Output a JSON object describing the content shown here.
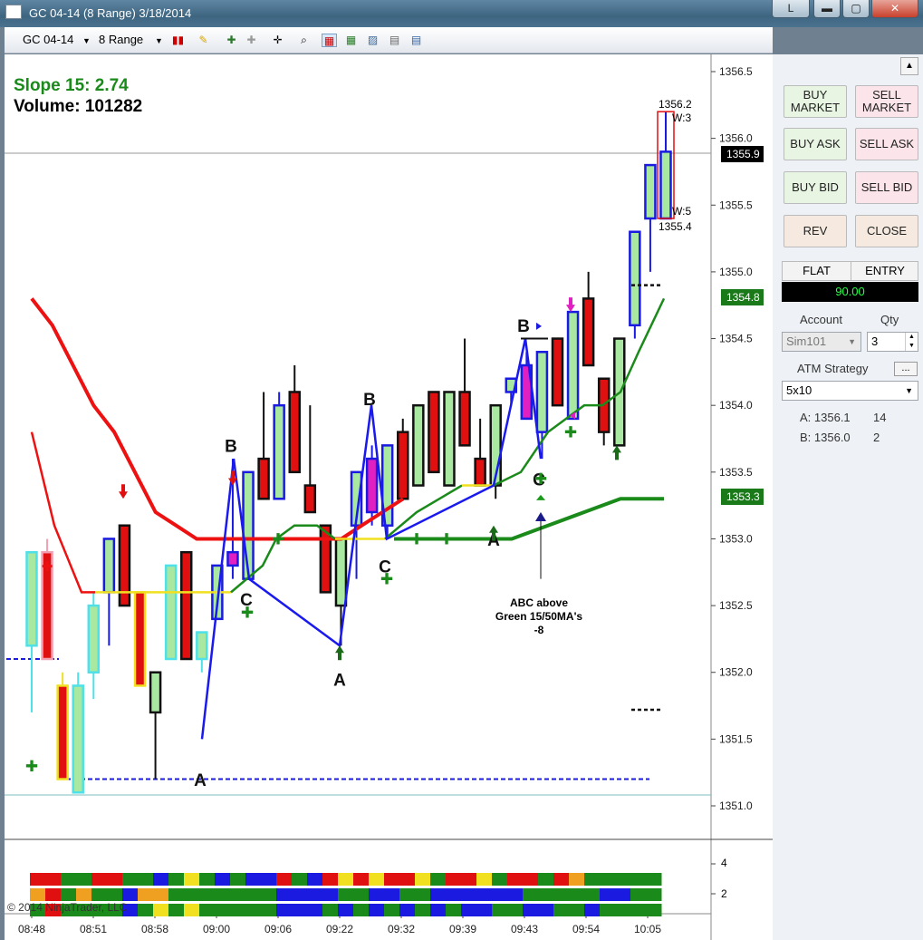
{
  "window": {
    "title": "GC 04-14 (8 Range)  3/18/2014",
    "btn_l": "L",
    "btn_min": "▬",
    "btn_max": "▢",
    "btn_close": "✕"
  },
  "toolbar": {
    "instrument": "GC 04-14",
    "period": "8 Range"
  },
  "chart": {
    "slope_label": "Slope 15: 2.74",
    "volume_label": "Volume: 101282",
    "copyright": "© 2014 NinjaTrader, LLC",
    "bar_high_label": "1356.2",
    "bar_w3": "W:3",
    "bar_w5": "W:5",
    "bar_low_label": "1355.4",
    "note_line1": "ABC above",
    "note_line2": "Green 15/50MA's",
    "note_line3": "-8",
    "price_tag_last": "1355.9",
    "price_tag_ma15": "1354.8",
    "price_tag_ma50": "1353.3",
    "lower_ticks": [
      "4",
      "2"
    ]
  },
  "chart_data": {
    "type": "candlestick",
    "y_axis": {
      "min": 1350.7,
      "max": 1356.6,
      "ticks": [
        "1356.5",
        "1356.0",
        "1355.5",
        "1355.0",
        "1354.5",
        "1354.0",
        "1353.5",
        "1353.0",
        "1352.5",
        "1352.0",
        "1351.5",
        "1351.0"
      ]
    },
    "x_ticks": [
      "08:48",
      "08:51",
      "08:58",
      "09:00",
      "09:06",
      "09:22",
      "09:32",
      "09:39",
      "09:43",
      "09:54",
      "10:05"
    ],
    "candles": [
      {
        "o": 1352.2,
        "h": 1352.6,
        "l": 1351.7,
        "c": 1352.9,
        "color": "cyan"
      },
      {
        "o": 1352.9,
        "h": 1353.0,
        "l": 1352.1,
        "c": 1352.1,
        "color": "pink"
      },
      {
        "o": 1351.9,
        "h": 1352.0,
        "l": 1351.2,
        "c": 1351.2,
        "color": "yellow"
      },
      {
        "o": 1351.1,
        "h": 1352.0,
        "l": 1351.1,
        "c": 1351.9,
        "color": "cyan"
      },
      {
        "o": 1352.0,
        "h": 1352.6,
        "l": 1351.8,
        "c": 1352.5,
        "color": "cyan"
      },
      {
        "o": 1352.6,
        "h": 1353.0,
        "l": 1352.2,
        "c": 1353.0,
        "color": "blue"
      },
      {
        "o": 1353.1,
        "h": 1353.1,
        "l": 1352.5,
        "c": 1352.5,
        "color": "red"
      },
      {
        "o": 1352.6,
        "h": 1352.6,
        "l": 1351.9,
        "c": 1351.9,
        "color": "yellow"
      },
      {
        "o": 1351.7,
        "h": 1352.0,
        "l": 1351.2,
        "c": 1352.0,
        "color": "black"
      },
      {
        "o": 1352.1,
        "h": 1352.8,
        "l": 1352.1,
        "c": 1352.8,
        "color": "cyan"
      },
      {
        "o": 1352.9,
        "h": 1352.9,
        "l": 1352.1,
        "c": 1352.1,
        "color": "red"
      },
      {
        "o": 1352.1,
        "h": 1352.3,
        "l": 1352.0,
        "c": 1352.3,
        "color": "cyan"
      },
      {
        "o": 1352.4,
        "h": 1352.8,
        "l": 1352.4,
        "c": 1352.8,
        "color": "blue"
      },
      {
        "o": 1352.9,
        "h": 1353.6,
        "l": 1352.7,
        "c": 1352.8,
        "color": "magenta"
      },
      {
        "o": 1352.7,
        "h": 1353.5,
        "l": 1352.7,
        "c": 1353.5,
        "color": "blue"
      },
      {
        "o": 1353.3,
        "h": 1354.1,
        "l": 1353.3,
        "c": 1353.6,
        "color": "red"
      },
      {
        "o": 1353.3,
        "h": 1354.1,
        "l": 1353.3,
        "c": 1354.0,
        "color": "blue"
      },
      {
        "o": 1354.1,
        "h": 1354.3,
        "l": 1353.5,
        "c": 1353.5,
        "color": "red"
      },
      {
        "o": 1353.4,
        "h": 1354.0,
        "l": 1353.2,
        "c": 1353.2,
        "color": "red"
      },
      {
        "o": 1353.1,
        "h": 1353.1,
        "l": 1352.6,
        "c": 1352.6,
        "color": "red"
      },
      {
        "o": 1352.5,
        "h": 1353.0,
        "l": 1352.2,
        "c": 1353.0,
        "color": "black"
      },
      {
        "o": 1353.1,
        "h": 1353.5,
        "l": 1352.7,
        "c": 1353.5,
        "color": "blue"
      },
      {
        "o": 1353.6,
        "h": 1353.7,
        "l": 1353.1,
        "c": 1353.2,
        "color": "magenta"
      },
      {
        "o": 1353.1,
        "h": 1353.7,
        "l": 1353.0,
        "c": 1353.7,
        "color": "blue"
      },
      {
        "o": 1353.8,
        "h": 1353.9,
        "l": 1353.3,
        "c": 1353.3,
        "color": "red"
      },
      {
        "o": 1353.4,
        "h": 1354.0,
        "l": 1353.4,
        "c": 1354.0,
        "color": "black"
      },
      {
        "o": 1354.1,
        "h": 1354.1,
        "l": 1353.5,
        "c": 1353.5,
        "color": "red"
      },
      {
        "o": 1353.4,
        "h": 1354.1,
        "l": 1353.4,
        "c": 1354.1,
        "color": "black"
      },
      {
        "o": 1354.1,
        "h": 1354.5,
        "l": 1353.7,
        "c": 1353.7,
        "color": "red"
      },
      {
        "o": 1353.6,
        "h": 1353.9,
        "l": 1353.4,
        "c": 1353.4,
        "color": "red"
      },
      {
        "o": 1353.4,
        "h": 1354.0,
        "l": 1353.3,
        "c": 1354.0,
        "color": "black"
      },
      {
        "o": 1354.1,
        "h": 1354.2,
        "l": 1354.0,
        "c": 1354.2,
        "color": "blue"
      },
      {
        "o": 1354.3,
        "h": 1354.4,
        "l": 1353.9,
        "c": 1353.9,
        "color": "magenta"
      },
      {
        "o": 1353.8,
        "h": 1354.4,
        "l": 1353.6,
        "c": 1354.4,
        "color": "blue"
      },
      {
        "o": 1354.5,
        "h": 1354.5,
        "l": 1354.0,
        "c": 1354.0,
        "color": "red"
      },
      {
        "o": 1353.9,
        "h": 1354.7,
        "l": 1353.9,
        "c": 1354.7,
        "color": "blue"
      },
      {
        "o": 1354.8,
        "h": 1355.0,
        "l": 1354.3,
        "c": 1354.3,
        "color": "red"
      },
      {
        "o": 1354.2,
        "h": 1354.2,
        "l": 1353.7,
        "c": 1353.8,
        "color": "red"
      },
      {
        "o": 1353.7,
        "h": 1354.5,
        "l": 1353.7,
        "c": 1354.5,
        "color": "black"
      },
      {
        "o": 1354.6,
        "h": 1355.3,
        "l": 1354.5,
        "c": 1355.3,
        "color": "blue"
      },
      {
        "o": 1355.4,
        "h": 1355.8,
        "l": 1355.0,
        "c": 1355.8,
        "color": "blue"
      },
      {
        "o": 1355.4,
        "h": 1356.2,
        "l": 1355.4,
        "c": 1355.9,
        "color": "blue"
      }
    ],
    "ma15": [
      1354.8,
      1354.5,
      1354.1,
      1353.8,
      1353.6,
      1353.3,
      1353.0,
      1352.9,
      1352.8,
      1353.0,
      1353.1,
      1353.1,
      1353.1,
      1353.0,
      1353.0,
      1353.0,
      1352.9,
      1352.9,
      1352.9,
      1352.9,
      1353.0,
      1353.1,
      1353.3,
      1353.3,
      1353.5,
      1353.7,
      1353.9,
      1354.0,
      1354.2,
      1354.5,
      1354.8
    ],
    "ma50": [
      1354.8,
      1354.6,
      1354.3,
      1354.0,
      1353.8,
      1353.5,
      1353.2,
      1353.1,
      1353.0,
      1353.0,
      1353.0,
      1353.0,
      1353.0,
      1353.0,
      1353.0,
      1353.0,
      1353.1,
      1353.2,
      1353.3
    ],
    "legend": "none"
  },
  "side": {
    "buy_market": "BUY MARKET",
    "sell_market": "SELL MARKET",
    "buy_ask": "BUY ASK",
    "sell_ask": "SELL ASK",
    "buy_bid": "BUY BID",
    "sell_bid": "SELL BID",
    "rev": "REV",
    "close": "CLOSE",
    "flat": "FLAT",
    "entry": "ENTRY",
    "pnl": "90.00",
    "account_label": "Account",
    "qty_label": "Qty",
    "account_value": "Sim101",
    "qty_value": "3",
    "atm_label": "ATM Strategy",
    "atm_btn": "...",
    "atm_value": "5x10",
    "order_a_label": "A: 1356.1",
    "order_a_qty": "14",
    "order_b_label": "B: 1356.0",
    "order_b_qty": "2"
  },
  "colors": {
    "ma15": "#1a8a1a",
    "ma50": "#ee1111",
    "panel_bg": "#6f8090"
  }
}
